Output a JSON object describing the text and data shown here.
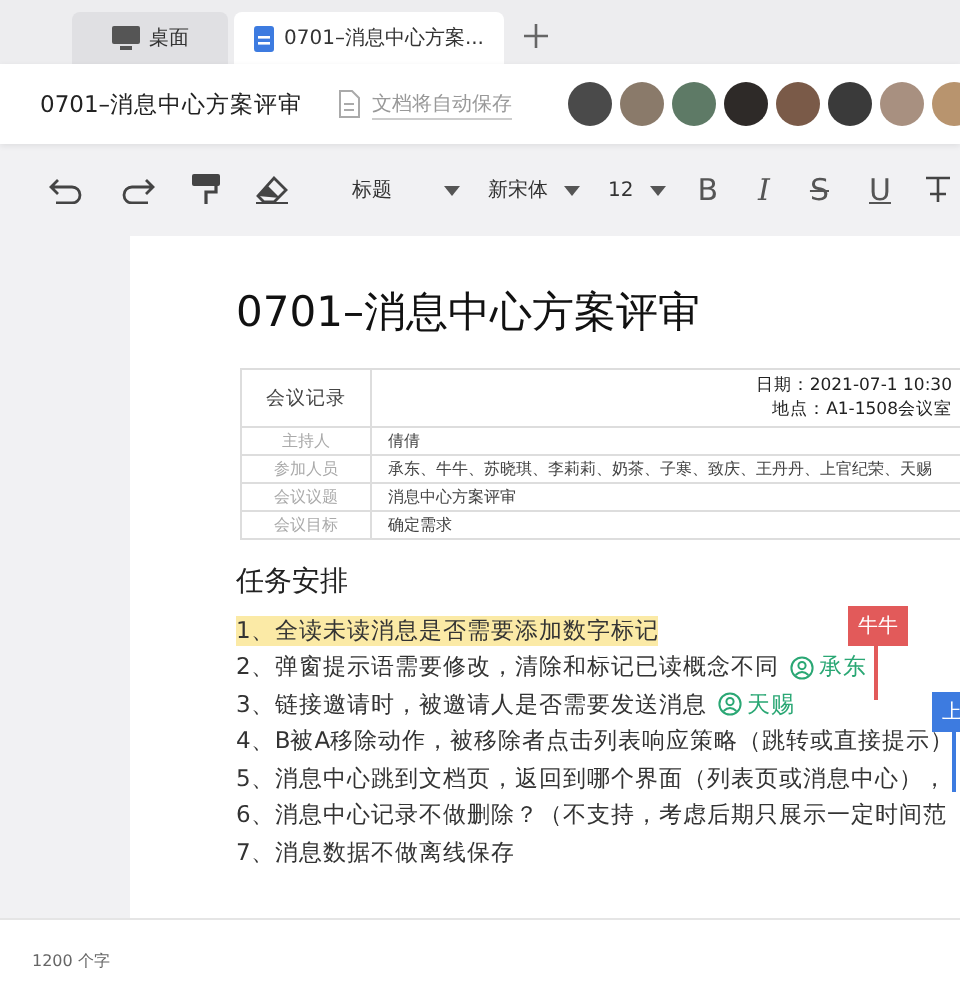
{
  "tabs": [
    {
      "label": "桌面",
      "kind": "desktop",
      "selected": false
    },
    {
      "label": "0701–消息中心方案...",
      "kind": "doc",
      "selected": true
    }
  ],
  "header": {
    "title": "0701–消息中心方案评审",
    "save_status": "文档将自动保存"
  },
  "toolbar": {
    "style": "标题",
    "font": "新宋体",
    "size": "12",
    "format_buttons": [
      "B",
      "I",
      "S",
      "U"
    ]
  },
  "document": {
    "title": "0701–消息中心方案评审",
    "meeting_table": {
      "heading": "会议记录",
      "date": "日期：2021-07-1 10:30",
      "place": "地点：A1-1508会议室",
      "rows": [
        {
          "label": "主持人",
          "value": "倩倩"
        },
        {
          "label": "参加人员",
          "value": "承东、牛牛、苏晓琪、李莉莉、奶茶、子寒、致庆、王丹丹、上官纪荣、天赐"
        },
        {
          "label": "会议议题",
          "value": "消息中心方案评审"
        },
        {
          "label": "会议目标",
          "value": "确定需求"
        }
      ]
    },
    "section_title": "任务安排",
    "tasks": [
      {
        "text": "1、全读未读消息是否需要添加数字标记",
        "highlighted": true
      },
      {
        "text": "2、弹窗提示语需要修改，清除和标记已读概念不同",
        "highlighted": false,
        "mention": "承东"
      },
      {
        "text": "3、链接邀请时，被邀请人是否需要发送消息",
        "highlighted": false,
        "mention": "天赐"
      },
      {
        "text": "4、B被A移除动作，被移除者点击列表响应策略（跳转或直接提示）",
        "highlighted": false
      },
      {
        "text": "5、消息中心跳到文档页，返回到哪个界面（列表页或消息中心），",
        "highlighted": false
      },
      {
        "text": "6、消息中心记录不做删除？（不支持，考虑后期只展示一定时间范",
        "highlighted": false
      },
      {
        "text": "7、消息数据不做离线保存",
        "highlighted": false
      }
    ],
    "cursors": [
      {
        "label": "牛牛",
        "color": "#e25a5a"
      },
      {
        "label": "上",
        "color": "#3d7be0"
      }
    ]
  },
  "status_bar": {
    "word_count": "1200 个字"
  }
}
